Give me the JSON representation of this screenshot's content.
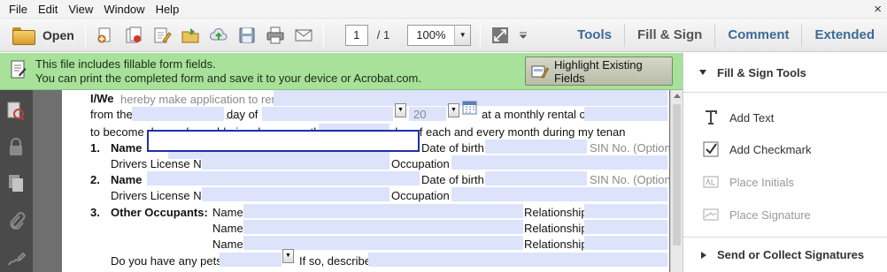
{
  "menu": {
    "items": [
      "File",
      "Edit",
      "View",
      "Window",
      "Help"
    ],
    "close_glyph": "×"
  },
  "toolbar": {
    "open_label": "Open",
    "page_current": "1",
    "page_total": "/ 1",
    "zoom": "100%",
    "tabs": [
      "Tools",
      "Fill & Sign",
      "Comment",
      "Extended"
    ],
    "active_tab": "Fill & Sign",
    "tab_color": "#3d6a96"
  },
  "notification": {
    "line1": "This file includes fillable form fields.",
    "line2": "You can print the completed form and save it to your device or Acrobat.com.",
    "button": "Highlight Existing Fields",
    "bg_color": "#a7e19a"
  },
  "form": {
    "iwe": "I/We",
    "intro": "hereby make application to rent",
    "from": "from the",
    "day_of": "day of",
    "year_prefix": "20",
    "monthly_rent": "at a monthly rental of $",
    "due": "to become due and payable in advance on the",
    "each_month": "day of each and every month during my tenan",
    "num1": "1.",
    "num2": "2.",
    "num3": "3.",
    "name": "Name",
    "dob": "Date of birth",
    "sin": "SIN No. (Option",
    "license": "Drivers License No.",
    "occupation": "Occupation",
    "other_occupants": "Other Occupants:",
    "relationship": "Relationship",
    "pets_q": "Do you have any pets?",
    "if_so": "If so, describe.",
    "field_color": "#dde3fb",
    "focus_color": "#1e2fa8"
  },
  "right_panel": {
    "section": "Fill & Sign Tools",
    "items": [
      {
        "label": "Add Text",
        "icon": "text-T-icon",
        "enabled": true
      },
      {
        "label": "Add Checkmark",
        "icon": "checkmark-icon",
        "enabled": true
      },
      {
        "label": "Place Initials",
        "icon": "initials-icon",
        "enabled": false
      },
      {
        "label": "Place Signature",
        "icon": "signature-icon",
        "enabled": false
      }
    ],
    "footer": "Send or Collect Signatures"
  }
}
